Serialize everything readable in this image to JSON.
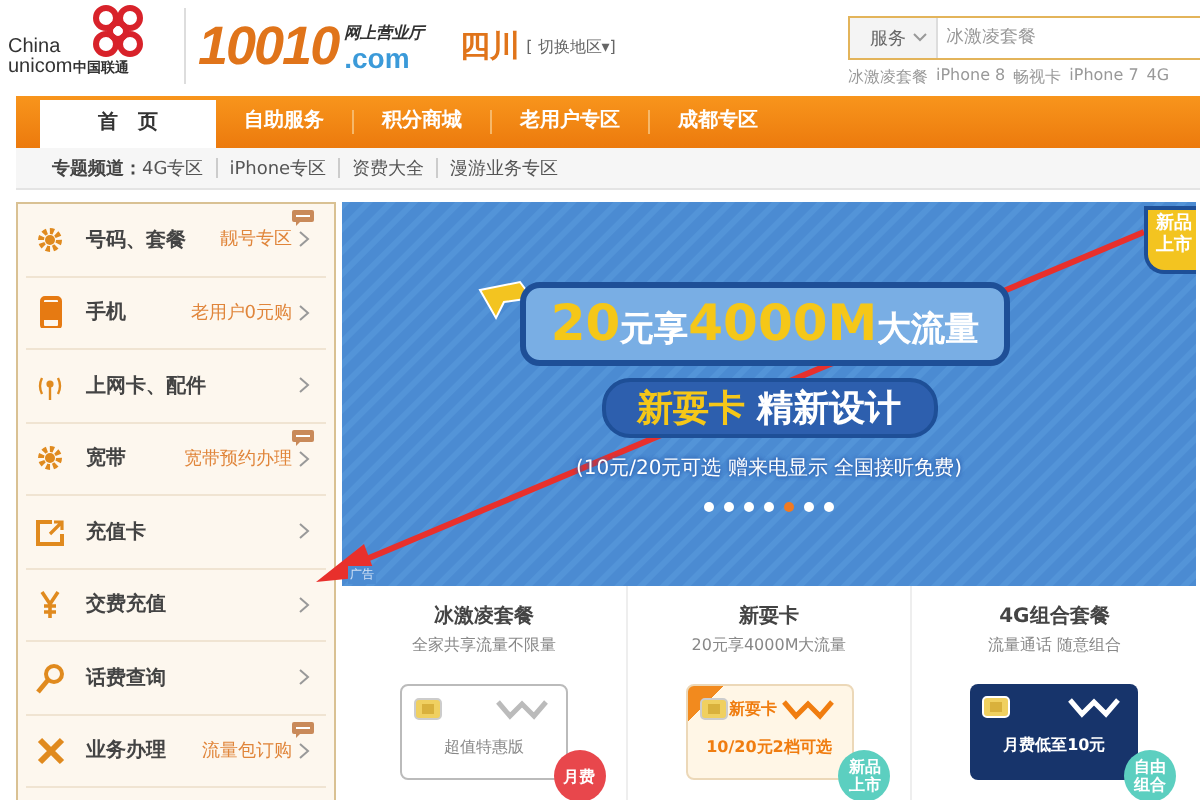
{
  "logo": {
    "line_1": "China",
    "line_2": "unicom",
    "chinese": "中国联通"
  },
  "site_logo": {
    "number": "10010",
    "tagline": "网上营业厅",
    "domain": ".com"
  },
  "region": {
    "name": "四川",
    "switch": "[ 切换地区▾]"
  },
  "search": {
    "category": "服务",
    "placeholder": "冰激凌套餐",
    "hot_words": [
      "冰激凌套餐",
      "iPhone 8",
      "畅视卡",
      "iPhone 7",
      "4G"
    ]
  },
  "nav": [
    {
      "label": "首　页",
      "selected": true
    },
    {
      "label": "自助服务",
      "selected": false
    },
    {
      "label": "积分商城",
      "selected": false
    },
    {
      "label": "老用户专区",
      "selected": false
    },
    {
      "label": "成都专区",
      "selected": false
    }
  ],
  "channels": {
    "label": "专题频道：",
    "links": [
      "4G专区",
      "iPhone专区",
      "资费大全",
      "漫游业务专区"
    ]
  },
  "sidebar": [
    {
      "kind": "gear",
      "label": "号码、套餐",
      "promo": "靓号专区",
      "hot": true
    },
    {
      "kind": "phone",
      "label": "手机",
      "promo": "老用户0元购",
      "hot": false
    },
    {
      "kind": "antenna",
      "label": "上网卡、配件",
      "hot": false
    },
    {
      "kind": "gear",
      "label": "宽带",
      "promo": "宽带预约办理",
      "hot": true
    },
    {
      "kind": "card",
      "label": "充值卡",
      "hot": false
    },
    {
      "kind": "yen",
      "label": "交费充值",
      "hot": false
    },
    {
      "kind": "search",
      "label": "话费查询",
      "hot": false
    },
    {
      "kind": "tools",
      "label": "业务办理",
      "promo": "流量包订购",
      "hot": true
    }
  ],
  "banner": {
    "headline": [
      {
        "kind": "number",
        "text": "20"
      },
      {
        "kind": "word",
        "text": "元享"
      },
      {
        "kind": "number",
        "text": "4000M"
      },
      {
        "kind": "word",
        "text": "大流量"
      }
    ],
    "subtitle": [
      {
        "kind": "number",
        "text": "新耍卡"
      },
      {
        "kind": "word",
        "text": "精新设计"
      }
    ],
    "note": "(10元/20元可选 赠来电显示 全国接听免费)",
    "corner": [
      "新品",
      "上市"
    ],
    "ad": "广告",
    "dots": [
      {
        "selected": false
      },
      {
        "selected": false
      },
      {
        "selected": false
      },
      {
        "selected": false
      },
      {
        "selected": true
      },
      {
        "selected": false
      },
      {
        "selected": false
      }
    ]
  },
  "products": [
    {
      "title": "冰激凌套餐",
      "subtitle": "全家共享流量不限量",
      "card": {
        "kind": "white",
        "text": "超值特惠版",
        "badge": "月费",
        "color": "#e8474c"
      }
    },
    {
      "title": "新耍卡",
      "subtitle": "20元享4000M大流量",
      "card": {
        "kind": "orange",
        "heading": "新耍卡",
        "text": "10/20元2档可选",
        "badge": "新品上市",
        "color": "#5ccfc0"
      }
    },
    {
      "title": "4G组合套餐",
      "subtitle": "流量通话 随意组合",
      "card": {
        "kind": "navy",
        "text": "月费低至10元",
        "badge": "自由组合",
        "color": "#5ccfc0"
      }
    }
  ]
}
